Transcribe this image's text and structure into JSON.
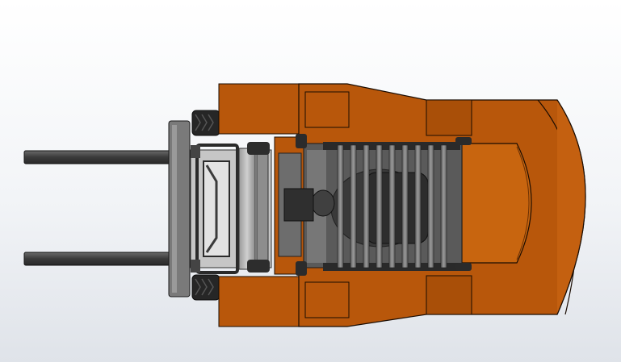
{
  "scene": {
    "subject": "forklift-top-view",
    "colors": {
      "background_top": "#ffffff",
      "background_bottom": "#dfe3e9",
      "body_orange": "#b8570b",
      "body_orange_dark": "#9e4706",
      "body_orange_light": "#c8650f",
      "outline": "#1a0c02",
      "steel_dark": "#3a3a3a",
      "steel_mid": "#6b6b6b",
      "steel_light": "#a9a9a9",
      "tire_black": "#262626"
    }
  }
}
